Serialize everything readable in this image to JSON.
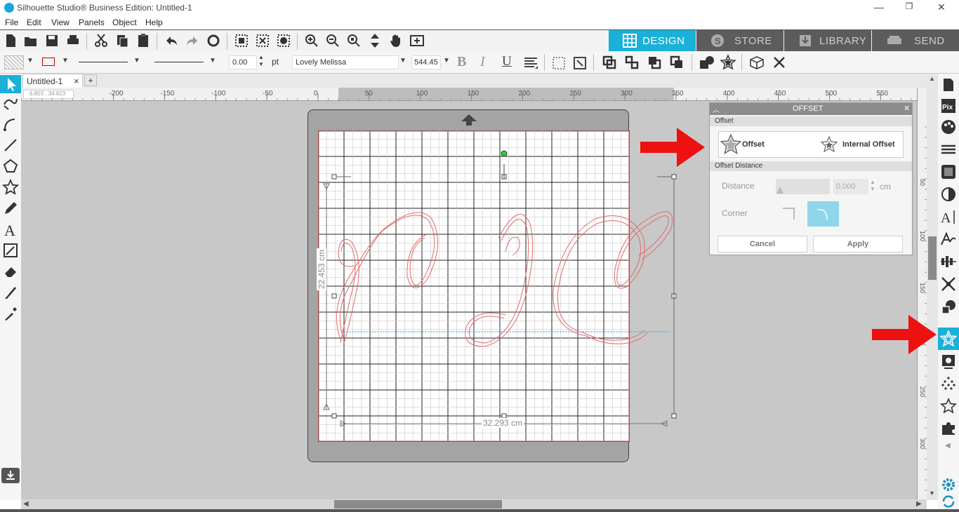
{
  "window": {
    "title": "Silhouette Studio® Business Edition: Untitled-1",
    "minimize": "—",
    "restore": "❐",
    "close": "✕"
  },
  "menu": [
    "File",
    "Edit",
    "View",
    "Panels",
    "Object",
    "Help"
  ],
  "tabs": {
    "design": "DESIGN",
    "store": "STORE",
    "library": "LIBRARY",
    "send": "SEND"
  },
  "toolbar2": {
    "line_width": "0.00",
    "line_unit": "pt",
    "font_name": "Lovely Melissa",
    "font_size": "544.45",
    "bold": "B",
    "italic": "I",
    "underline": "U"
  },
  "document": {
    "tab_name": "Untitled-1",
    "close": "×",
    "add": "+",
    "coordinates": "6.803 , 34.823"
  },
  "ruler_h": [
    "-200",
    "-150",
    "-100",
    "-50",
    "0",
    "50",
    "100",
    "150",
    "200",
    "250",
    "300",
    "350",
    "400",
    "450",
    "500",
    "550"
  ],
  "ruler_v": [
    "50",
    "100",
    "150",
    "200",
    "250",
    "300"
  ],
  "selection": {
    "height_label": "22.453 cm",
    "width_label": "32.293 cm"
  },
  "offset_panel": {
    "title": "OFFSET",
    "section_offset": "Offset",
    "offset_button": "Offset",
    "internal_offset_button": "Internal Offset",
    "section_distance": "Offset Distance",
    "distance_label": "Distance",
    "distance_value": "0.000",
    "distance_unit": "cm",
    "corner_label": "Corner",
    "cancel": "Cancel",
    "apply": "Apply"
  },
  "colors": {
    "accent": "#1ab0d8",
    "tab_bg": "#5c5c5c",
    "annotation_arrow": "#ee1111",
    "cut_line": "#e05050"
  }
}
